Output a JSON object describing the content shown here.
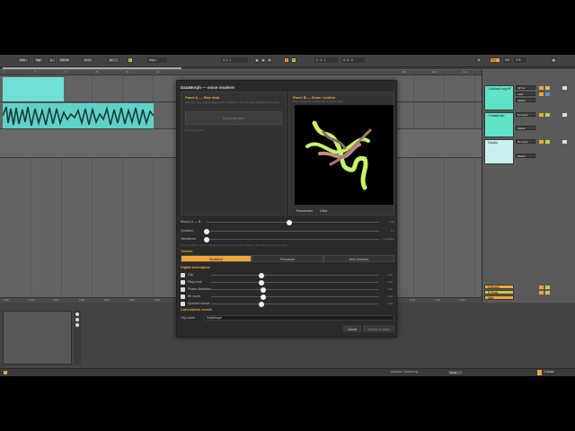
{
  "toolbar": {
    "link": "Link",
    "tap": "Tap",
    "tempo": "100.00",
    "meter": "4 / 4",
    "key": "C",
    "scale": "Major",
    "position": "3. 1. 1",
    "loop_start": "1 . 1 . 1",
    "loop_len": "4 . 0 . 0",
    "key_btn": "Key",
    "midi": "MIDI",
    "cpu": "4 %"
  },
  "ruler": {
    "bars": [
      "1",
      "9",
      "17",
      "25",
      "33",
      "41",
      "49",
      "57",
      "65",
      "73",
      "81",
      "89",
      "97",
      "105",
      "113",
      "121",
      "129",
      "137"
    ]
  },
  "time_ruler": {
    "labels": [
      "0:00",
      "0:10",
      "0:20",
      "0:30",
      "0:40",
      "0:50",
      "1:00",
      "1:10",
      "1:20",
      "1:30",
      "1:40",
      "1:50",
      "2:00"
    ]
  },
  "tracks": [
    {
      "name": "1 Anchor/Long-HF",
      "color": "#5fe3c8",
      "input": "All Ins",
      "monitor": "Auto",
      "output": "Master"
    },
    {
      "name": "2 DataMorph",
      "color": "#5fe3c8",
      "input": "No Input",
      "monitor": "Auto",
      "output": "Master"
    },
    {
      "name": "3 Audio",
      "color": "#c8f0ee",
      "input": "No Input",
      "monitor": "Auto",
      "output": "Master"
    }
  ],
  "returns": [
    {
      "name": "A Reverb",
      "color": "#f0a53a"
    },
    {
      "name": "B Delay",
      "color": "#d8c24a"
    },
    {
      "name": "Main",
      "color": "#f0a53a"
    }
  ],
  "dialog": {
    "title": "DataMorph — noise renderer",
    "panel_a": {
      "title": "Panel A — Raw data",
      "desc": "Drop file, text, paste image, audio, whichever. Its raw bytes become the source.",
      "drop": "Drag a file here",
      "empty": "No data loaded"
    },
    "panel_b": {
      "title": "Panel B — Draw / motion",
      "desc": "Draw shape, or load/render a motion field.",
      "btn_randomize": "Randomize",
      "btn_clear": "Clear"
    },
    "morph": {
      "label": "Morph A ↔ B",
      "value": "0.50",
      "fraction": 0.48
    },
    "duration": {
      "label": "Duration",
      "value": "5 s",
      "fraction": 0.0
    },
    "variations": {
      "label": "Variations",
      "value": "1 variation",
      "fraction": 0.0
    },
    "note": "Each variation uses an independently seeded random stream, depending on the pen step.",
    "texture": {
      "header": "Texture",
      "options": [
        "Sustained",
        "Percussive",
        "Both (random)"
      ],
      "selected": 0
    },
    "dsp": {
      "header": "Digital techniques",
      "items": [
        {
          "label": "Clip",
          "value": "0.30",
          "fraction": 0.3
        },
        {
          "label": "Ring mod",
          "value": "0.30",
          "fraction": 0.3
        },
        {
          "label": "Phase distortion",
          "value": "0.30",
          "fraction": 0.31
        },
        {
          "label": "Bit crush",
          "value": "0.30",
          "fraction": 0.31
        },
        {
          "label": "Spectral smear",
          "value": "0.30",
          "fraction": 0.3
        }
      ]
    },
    "convolution": {
      "header": "Convolution reverb",
      "clip_label": "Clip name",
      "clip_value": "DataMorph"
    },
    "buttons": {
      "cancel": "Cancel",
      "render": "Render & Insert"
    }
  },
  "status": {
    "text": "Analysis: Searching...",
    "btn": "None",
    "track": "2-Audio"
  }
}
